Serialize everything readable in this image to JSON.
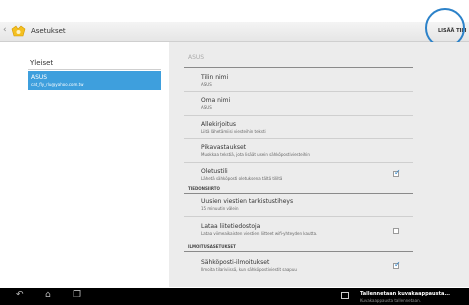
{
  "header": {
    "title": "Asetukset",
    "add_account": "LISÄÄ TILI"
  },
  "left": {
    "section": "Yleiset",
    "account": {
      "name": "ASUS",
      "email": "cat_fly_rlu@yahoo.com.tw"
    }
  },
  "right": {
    "header": "ASUS",
    "items": [
      {
        "title": "Tilin nimi",
        "subtitle": "ASUS"
      },
      {
        "title": "Oma nimi",
        "subtitle": "ASUS"
      },
      {
        "title": "Allekirjoitus",
        "subtitle": "Liitä lähetämiisi viesteihin teksti"
      },
      {
        "title": "Pikavastaukset",
        "subtitle": "Muokkaa tekstiä, jota lisäät usein sähköpostiviesteihin"
      },
      {
        "title": "Oletustili",
        "subtitle": "Lähetä sähköposti oletuksena tältä tililtä",
        "checked": true
      },
      {
        "title": "Uusien viestien tarkistustiheys",
        "subtitle": "15 minuutin välein"
      },
      {
        "title": "Lataa liitetiedostoja",
        "subtitle": "Lataa viimeaikaisten viestien liitteet wifi-yhteyden kautta.",
        "checked": false
      },
      {
        "title": "Sähköposti-ilmoitukset",
        "subtitle": "Ilmoita tilariviissä, kun sähköpostiviestit saapuu",
        "checked": true
      }
    ],
    "sections": {
      "sync": "TIEDONSIIRTO",
      "notifications": "ILMOITUSASETUKSET"
    }
  },
  "statusbar": {
    "toast_title": "Tallennetaan kuvakaappausta...",
    "toast_sub": "Kuvakaappausta tallennetaan."
  },
  "colors": {
    "accent": "#3e9fdd",
    "circle": "#2c82c9",
    "navbar": "#000000"
  }
}
